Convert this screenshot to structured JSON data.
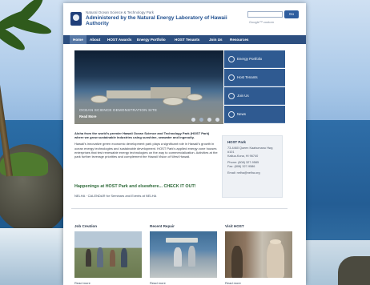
{
  "header": {
    "kicker": "Natural Ocean Science & Technology Park",
    "title": "Administered by the Natural Energy Laboratory of Hawaii Authority",
    "search_placeholder": "",
    "search_button": "Go",
    "google_tag": "Google™ custom"
  },
  "nav": {
    "items": [
      "Home",
      "About",
      "HOST Awards",
      "Energy Portfolio",
      "HOST Tenants",
      "Join Us",
      "Resources"
    ]
  },
  "hero": {
    "caption": "OCEAN SCIENCE DEMONSTRATION SITE",
    "more": "Read More"
  },
  "side_menu": {
    "items": [
      "Energy Portfolio",
      "Host Tenants",
      "Join Us",
      "News"
    ]
  },
  "intro": {
    "lead": "Aloha from the world's premier Hawaii Ocean Science and Technology Park (HOST Park) where we grow sustainable industries using sunshine, seawater and ingenuity.",
    "body": "Hawaii's innovative green economic development park plays a significant role in Hawaii's growth in ocean energy technologies and sustainable development. HOST Park's applied energy zone houses enterprises that test renewable energy technologies on the way to commercialization. Activities at the park further leverage priorities and complement the Hawaii Vision of West Hawaii.",
    "happenings": "Happenings at HOST Park and elsewhere... CHECK IT OUT!",
    "calendar": "NELHA · CALENDAR for Seminars and Events at NELHA"
  },
  "contact": {
    "title": "HOST Park",
    "address_1": "73-4460 Queen Kaahumanu Hwy, #101",
    "address_2": "Kailua-Kona, HI 96740",
    "phone": "Phone: (808) 327-9585",
    "fax": "Fax: (808) 327-9586",
    "email": "Email: nelha@nelha.org"
  },
  "cards": [
    {
      "title": "Job Creation",
      "more": "Read more"
    },
    {
      "title": "Recent Repair",
      "more": "Read more"
    },
    {
      "title": "Visit HOST",
      "more": "Read more"
    }
  ]
}
